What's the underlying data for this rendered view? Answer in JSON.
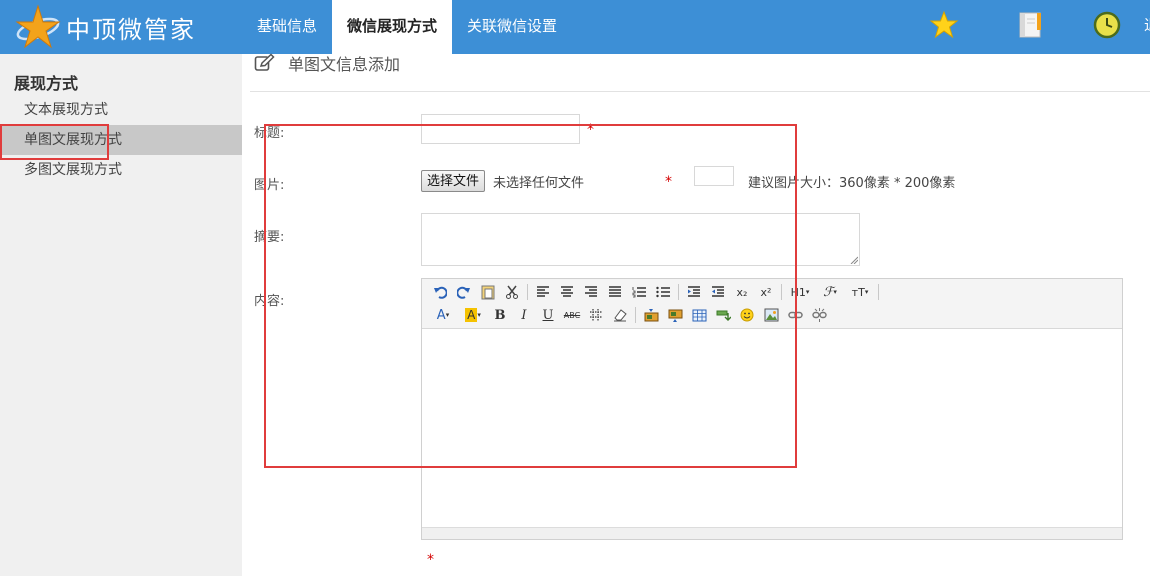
{
  "app": {
    "brand": "中顶微管家"
  },
  "nav": {
    "items": [
      {
        "label": "基础信息"
      },
      {
        "label": "微信展现方式"
      },
      {
        "label": "关联微信设置"
      }
    ],
    "right_icons": [
      "star-icon",
      "notebook-icon",
      "clock-icon"
    ],
    "cut_text": "退"
  },
  "sidebar": {
    "title": "展现方式",
    "items": [
      {
        "label": "文本展现方式"
      },
      {
        "label": "单图文展现方式"
      },
      {
        "label": "多图文展现方式"
      }
    ]
  },
  "page": {
    "title": "单图文信息添加"
  },
  "form": {
    "title_label": "标题:",
    "image_label": "图片:",
    "summary_label": "摘要:",
    "content_label": "内容:",
    "required_mark": "*",
    "file_button": "选择文件",
    "file_none": "未选择任何文件",
    "image_hint": "建议图片大小：360像素 * 200像素"
  },
  "editor": {
    "heading_button": "H1",
    "font_size_button": "тT",
    "font_color_button": "A",
    "bg_color_button": "A",
    "bold": "B",
    "italic": "I",
    "underline": "U",
    "strike": "ABC",
    "superscript": "x²",
    "subscript": "x₂"
  },
  "colors": {
    "topbar": "#3d8fd6",
    "sidebar": "#f0f0f0",
    "sidebar_active": "#c8c8c8",
    "required": "#d40000",
    "annotation": "#e03c3c"
  }
}
